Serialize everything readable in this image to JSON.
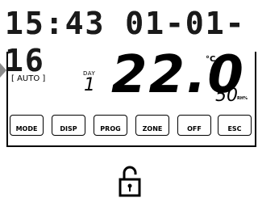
{
  "clock": {
    "display": "15:43 01-01-16"
  },
  "mode": {
    "label": "AUTO"
  },
  "day": {
    "label": "DAY",
    "value": "1"
  },
  "temperature": {
    "value": "22.0",
    "unit": "°C"
  },
  "humidity": {
    "value": "50",
    "unit": "RH%"
  },
  "buttons": [
    {
      "label": "MODE"
    },
    {
      "label": "DISP"
    },
    {
      "label": "PROG"
    },
    {
      "label": "ZONE"
    },
    {
      "label": "OFF"
    },
    {
      "label": "ESC"
    }
  ],
  "icons": {
    "left_arrow": "left-pointer-icon",
    "lock": "unlocked-padlock-icon"
  }
}
